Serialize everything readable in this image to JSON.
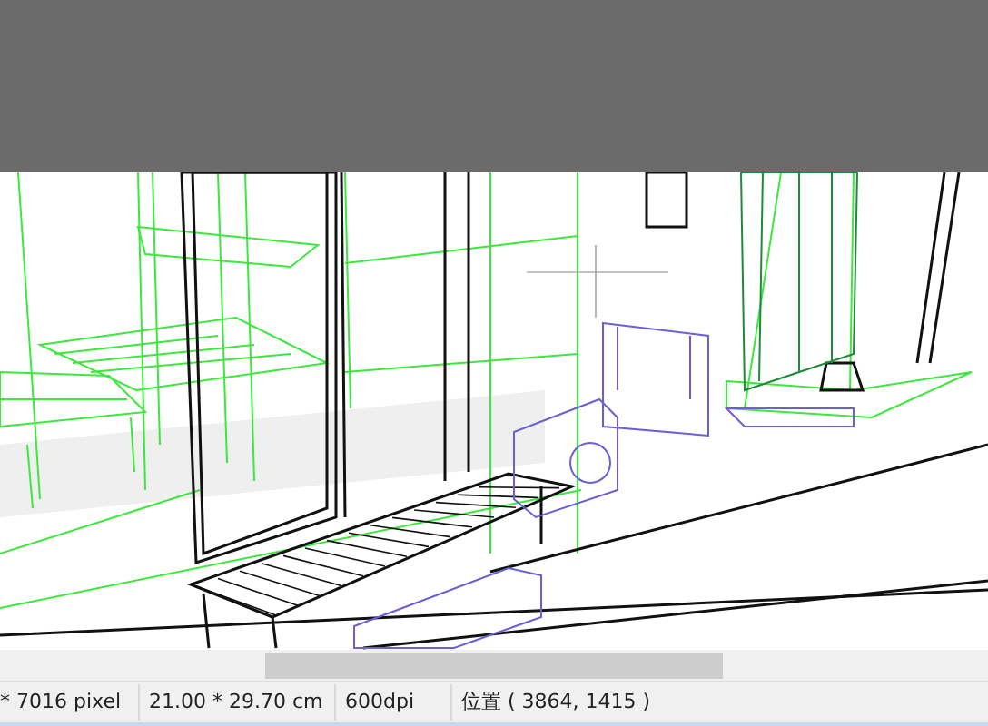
{
  "status_bar": [
    {
      "text": "* 7016 pixel"
    },
    {
      "text": "21.00 * 29.70 cm"
    },
    {
      "text": "600dpi"
    },
    {
      "text": "位置 ( 3864, 1415 )"
    }
  ]
}
